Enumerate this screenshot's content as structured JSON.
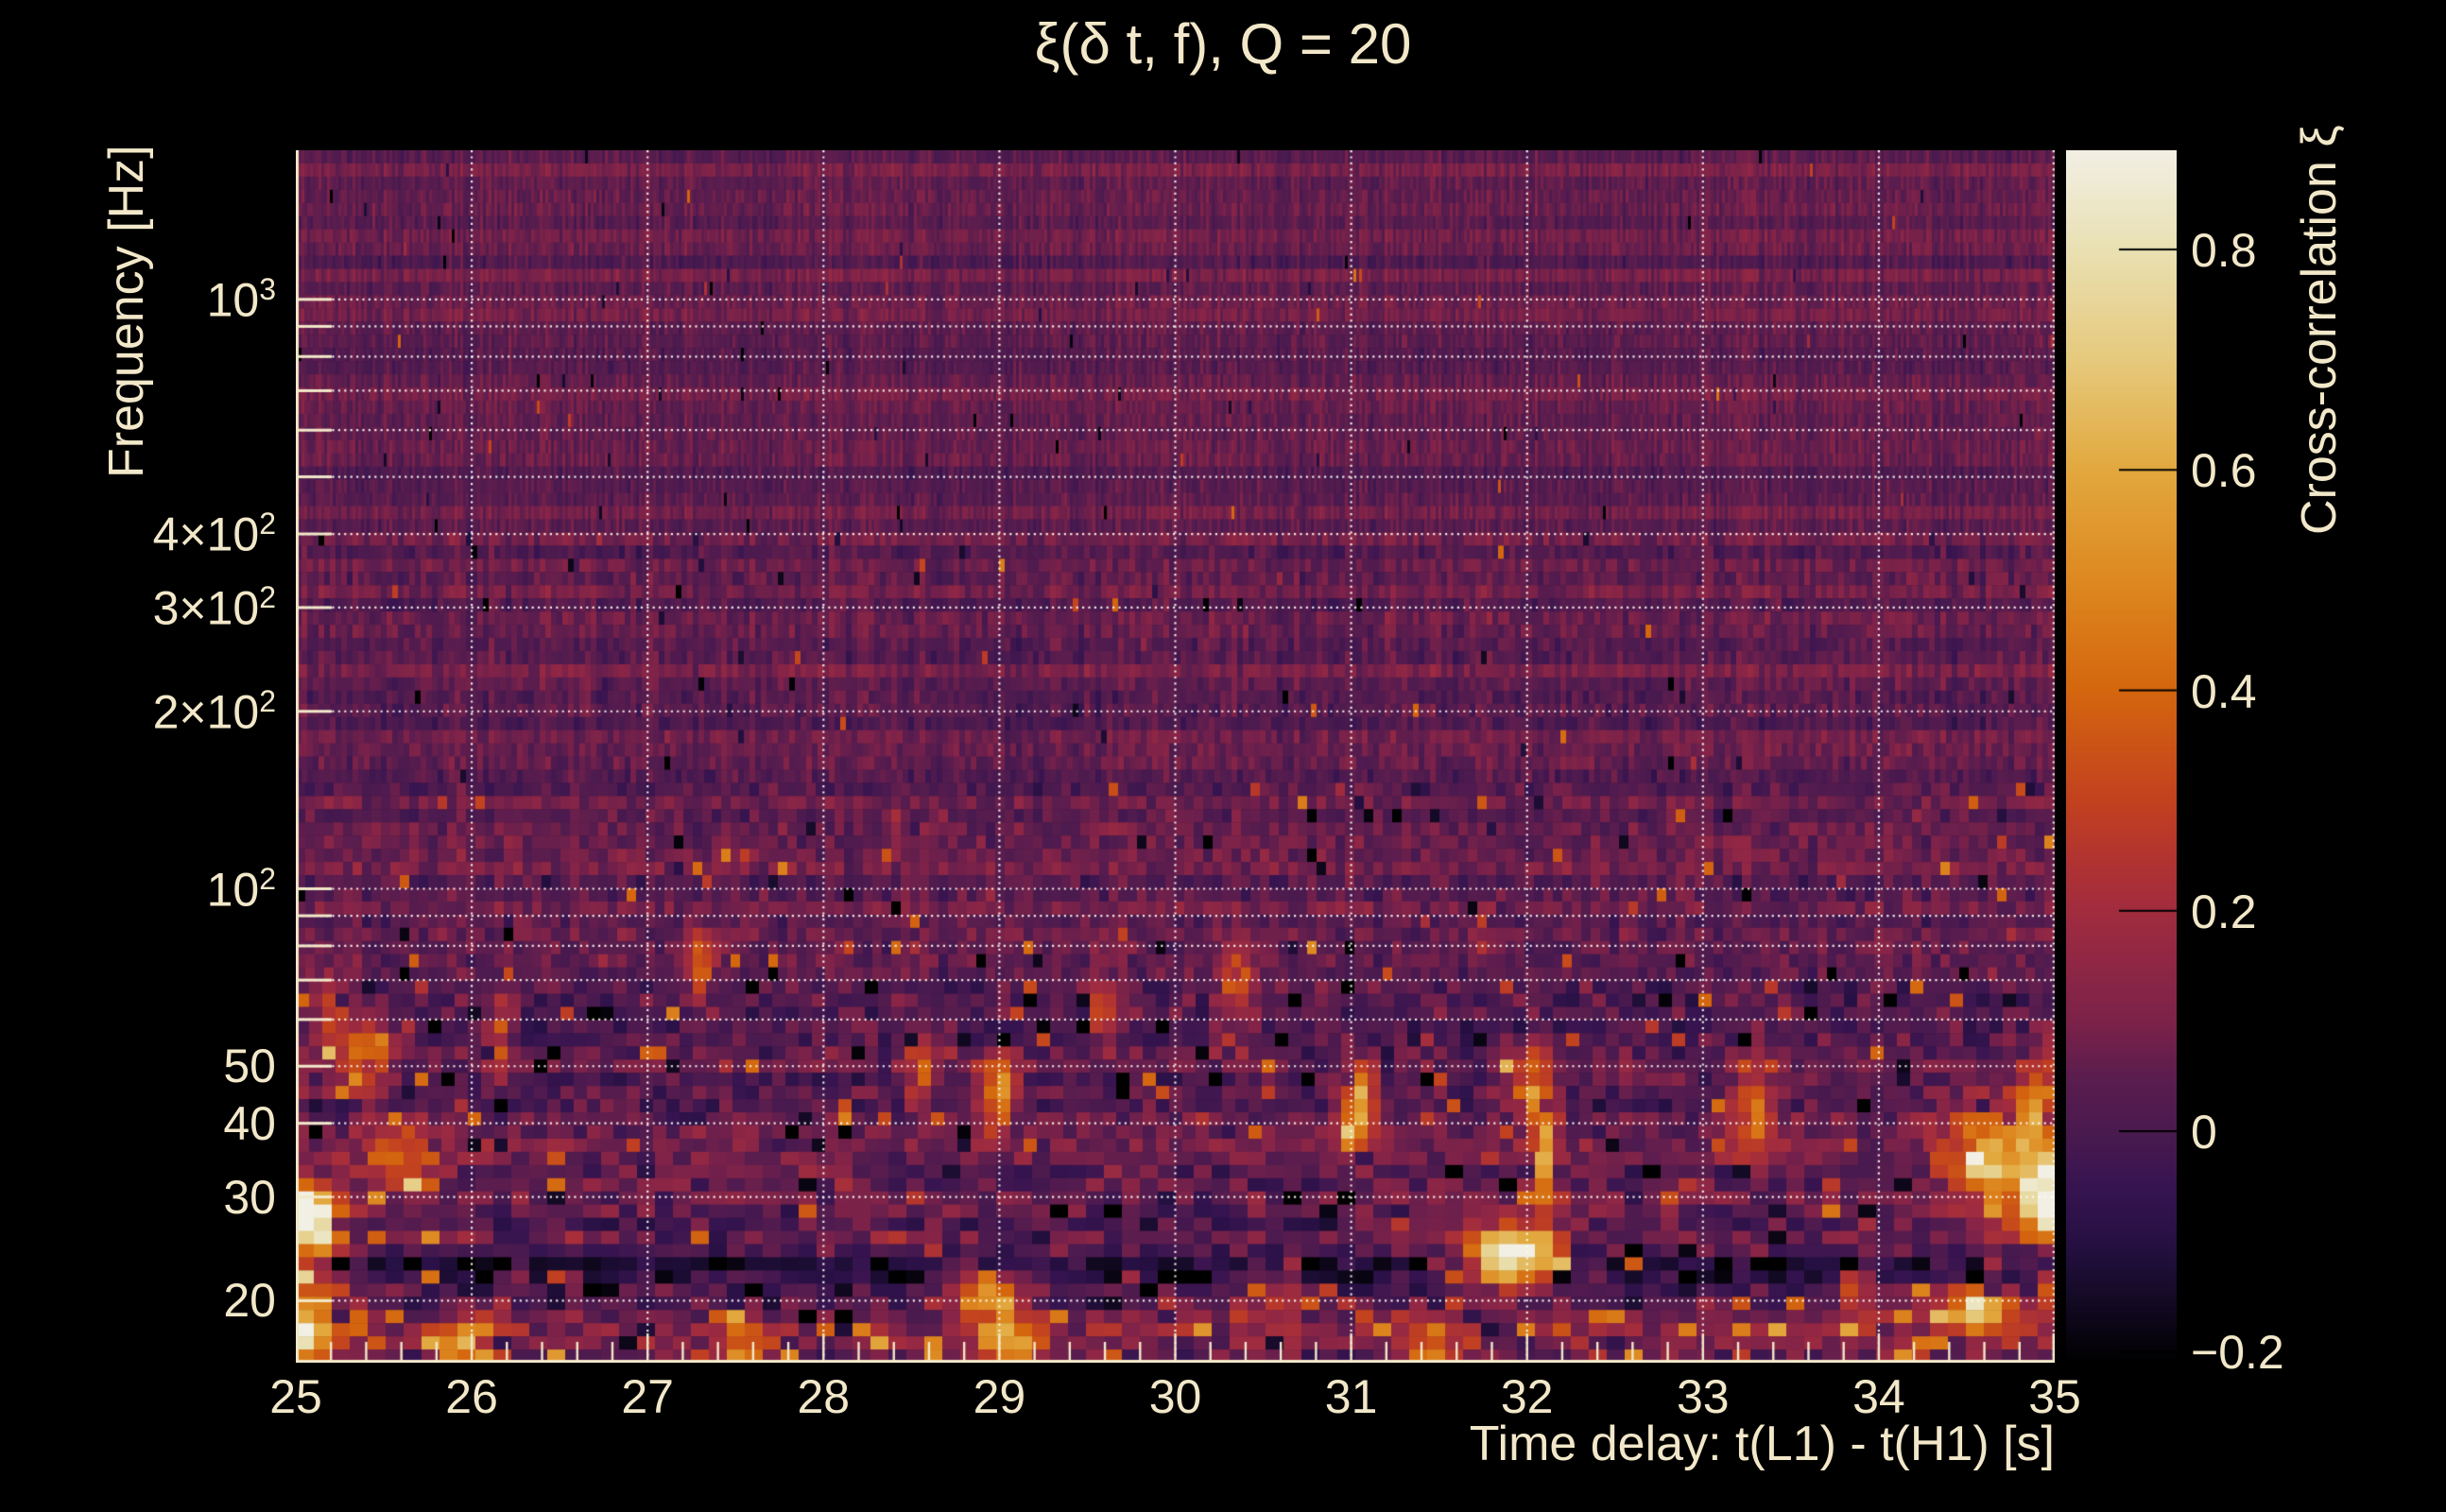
{
  "title": "ξ(δ t, f), Q = 20",
  "colors": {
    "background": "#000000",
    "text": "#f2e8c9",
    "grid": "#fdfbf3",
    "axis_line": "#f2e8c9",
    "colorbar_tick": "#000000"
  },
  "chart_data": {
    "type": "heatmap",
    "title": "ξ(δ t, f), Q = 20",
    "xlabel": "Time delay: t(L1) - t(H1) [s]",
    "ylabel": "Frequency [Hz]",
    "colorbar_label": "Cross-correlation ξ",
    "x_range": [
      25,
      35
    ],
    "x_scale": "linear",
    "y_range_hz": [
      15.7,
      1791
    ],
    "y_scale": "log",
    "value_range": [
      -0.21,
      0.89
    ],
    "grid": true,
    "x_ticks": [
      {
        "label": "25",
        "t": 25
      },
      {
        "label": "26",
        "t": 26
      },
      {
        "label": "27",
        "t": 27
      },
      {
        "label": "28",
        "t": 28
      },
      {
        "label": "29",
        "t": 29
      },
      {
        "label": "30",
        "t": 30
      },
      {
        "label": "31",
        "t": 31
      },
      {
        "label": "32",
        "t": 32
      },
      {
        "label": "33",
        "t": 33
      },
      {
        "label": "34",
        "t": 34
      },
      {
        "label": "35",
        "t": 35
      }
    ],
    "x_minor_step": 0.2,
    "y_ticks": [
      {
        "base": "10",
        "sup": "3",
        "f": 1000
      },
      {
        "base": "4×10",
        "sup": "2",
        "f": 400
      },
      {
        "base": "3×10",
        "sup": "2",
        "f": 300
      },
      {
        "base": "2×10",
        "sup": "2",
        "f": 200
      },
      {
        "base": "10",
        "sup": "2",
        "f": 100
      },
      {
        "base": "50",
        "sup": "",
        "f": 50
      },
      {
        "base": "40",
        "sup": "",
        "f": 40
      },
      {
        "base": "30",
        "sup": "",
        "f": 30
      },
      {
        "base": "20",
        "sup": "",
        "f": 20
      }
    ],
    "grid_freqs": [
      20,
      30,
      40,
      50,
      60,
      70,
      80,
      90,
      100,
      200,
      300,
      400,
      500,
      600,
      700,
      800,
      900,
      1000
    ],
    "x_grid": [
      26,
      27,
      28,
      29,
      30,
      31,
      32,
      33,
      34,
      35
    ],
    "colorbar_ticks": [
      {
        "v": 0.8,
        "label": "0.8"
      },
      {
        "v": 0.6,
        "label": "0.6"
      },
      {
        "v": 0.4,
        "label": "0.4"
      },
      {
        "v": 0.2,
        "label": "0.2"
      },
      {
        "v": 0.0,
        "label": "0"
      },
      {
        "v": -0.2,
        "label": "−0.2"
      }
    ],
    "colormap": [
      [
        -0.21,
        "#000000"
      ],
      [
        -0.15,
        "#140a26"
      ],
      [
        -0.1,
        "#261043"
      ],
      [
        -0.05,
        "#371450"
      ],
      [
        0.0,
        "#4a1a4f"
      ],
      [
        0.05,
        "#5b1d4e"
      ],
      [
        0.1,
        "#7c2249"
      ],
      [
        0.15,
        "#8e2645"
      ],
      [
        0.2,
        "#a12c3e"
      ],
      [
        0.25,
        "#b23430"
      ],
      [
        0.3,
        "#c2411f"
      ],
      [
        0.4,
        "#d4660e"
      ],
      [
        0.5,
        "#dd8820"
      ],
      [
        0.6,
        "#e2a83e"
      ],
      [
        0.7,
        "#e6c97c"
      ],
      [
        0.8,
        "#e9e0b2"
      ],
      [
        0.89,
        "#f2efe4"
      ]
    ],
    "hotspots": [
      [
        25.08,
        27.5,
        1.0,
        0.13,
        0.04
      ],
      [
        25.05,
        21.0,
        0.45,
        0.15,
        0.035
      ],
      [
        25.08,
        17.5,
        0.5,
        0.1,
        0.035
      ],
      [
        25.4,
        53.0,
        0.4,
        0.1,
        0.045
      ],
      [
        25.6,
        35.0,
        0.3,
        0.15,
        0.05
      ],
      [
        25.2,
        62.0,
        0.28,
        0.07,
        0.045
      ],
      [
        26.0,
        16.5,
        0.5,
        0.12,
        0.035
      ],
      [
        26.15,
        57.0,
        0.28,
        0.06,
        0.045
      ],
      [
        27.3,
        75.0,
        0.32,
        0.06,
        0.045
      ],
      [
        27.55,
        16.5,
        0.4,
        0.1,
        0.035
      ],
      [
        28.55,
        49.0,
        0.33,
        0.06,
        0.045
      ],
      [
        28.9,
        20.5,
        0.5,
        0.15,
        0.03
      ],
      [
        29.0,
        45.0,
        0.48,
        0.07,
        0.045
      ],
      [
        29.05,
        16.8,
        0.45,
        0.12,
        0.035
      ],
      [
        29.6,
        63.0,
        0.28,
        0.06,
        0.045
      ],
      [
        30.35,
        70.0,
        0.32,
        0.08,
        0.045
      ],
      [
        30.6,
        20.5,
        0.3,
        0.1,
        0.03
      ],
      [
        31.05,
        43.0,
        0.55,
        0.08,
        0.05
      ],
      [
        31.45,
        16.5,
        0.4,
        0.1,
        0.035
      ],
      [
        31.9,
        23.8,
        1.0,
        0.18,
        0.035
      ],
      [
        32.1,
        36.0,
        0.48,
        0.05,
        0.095
      ],
      [
        32.0,
        45.5,
        0.4,
        0.06,
        0.045
      ],
      [
        33.28,
        42.0,
        0.42,
        0.09,
        0.055
      ],
      [
        33.9,
        21.0,
        0.3,
        0.1,
        0.03
      ],
      [
        34.55,
        19.5,
        0.6,
        0.18,
        0.03
      ],
      [
        34.65,
        35.0,
        0.5,
        0.2,
        0.065
      ],
      [
        34.9,
        43.0,
        0.45,
        0.08,
        0.05
      ],
      [
        34.95,
        29.5,
        0.95,
        0.1,
        0.045
      ]
    ],
    "dark_band": {
      "f": 23,
      "amp": 0.13,
      "sigma_logf": 0.022
    },
    "noise": {
      "seed": 42,
      "base": 0.05,
      "description": "mottled cross-correlation noise, variance increasing toward low frequency, fine vertical striping above ~200 Hz"
    }
  }
}
